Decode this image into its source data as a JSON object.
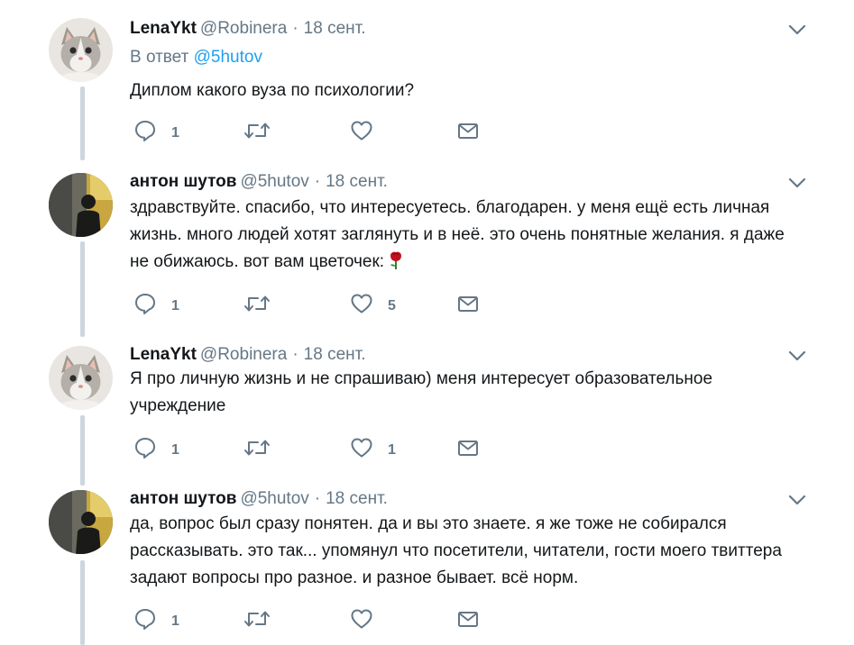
{
  "tweets": [
    {
      "name": "LenaYkt",
      "handle": "@Robinera",
      "dot": "·",
      "date": "18 сент.",
      "reply_prefix": "В ответ",
      "reply_handle": "@5hutov",
      "text": "Диплом какого вуза по психологии?",
      "replies": "1",
      "likes": "",
      "avatar": "cat"
    },
    {
      "name": "антон шутов",
      "handle": "@5hutov",
      "dot": "·",
      "date": "18 сент.",
      "text": "здравствуйте. спасибо, что интересуетесь. благодарен. у меня ещё есть личная жизнь. много людей хотят заглянуть и в неё. это очень понятные желания. я даже не обижаюсь. вот вам цветочек:",
      "replies": "1",
      "likes": "5",
      "avatar": "person"
    },
    {
      "name": "LenaYkt",
      "handle": "@Robinera",
      "dot": "·",
      "date": "18 сент.",
      "text": "Я про личную жизнь и не спрашиваю) меня интересует образовательное учреждение",
      "replies": "1",
      "likes": "1",
      "avatar": "cat"
    },
    {
      "name": "антон шутов",
      "handle": "@5hutov",
      "dot": "·",
      "date": "18 сент.",
      "text": "да, вопрос был сразу понятен. да и вы это знаете. я же тоже не собирался рассказывать. это так... упомянул что посетители, читатели, гости моего твиттера задают вопросы про разное. и разное бывает.  всё норм.",
      "replies": "1",
      "likes": "",
      "avatar": "person"
    }
  ],
  "icons": {
    "reply": "reply-icon",
    "retweet": "retweet-icon",
    "like": "heart-icon",
    "message": "envelope-icon",
    "more": "chevron-down-icon",
    "flower": "rose-emoji"
  },
  "colors": {
    "text": "#14171a",
    "muted": "#657786",
    "link": "#1da1f2",
    "thread": "#ccd6dd",
    "rose": "#c2101f"
  }
}
